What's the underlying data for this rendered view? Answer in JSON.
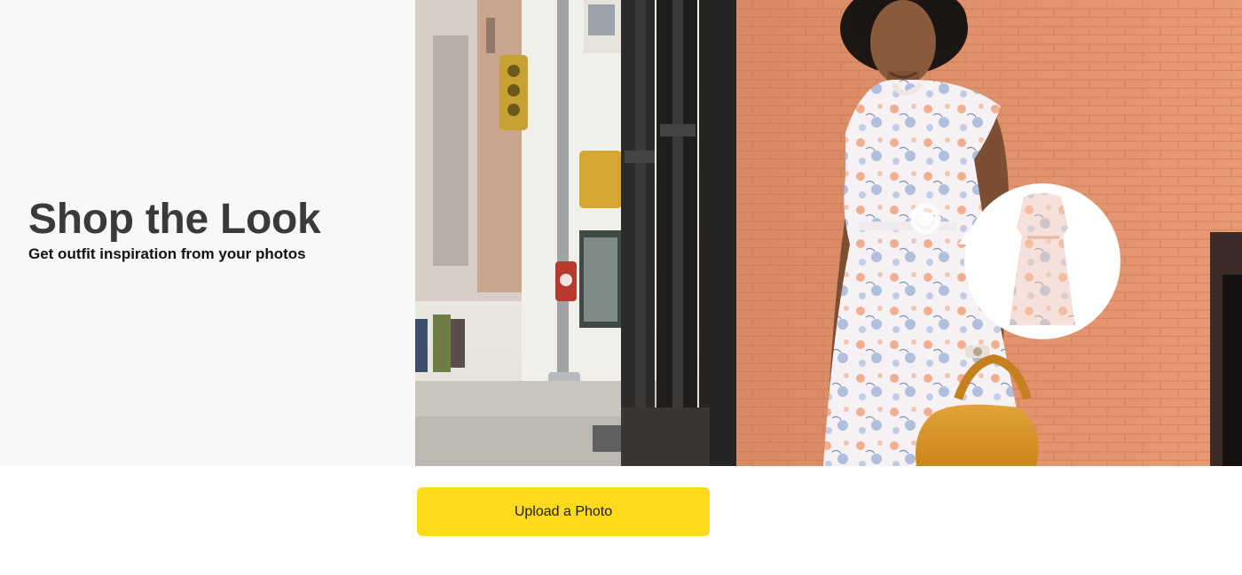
{
  "hero": {
    "title": "Shop the Look",
    "subtitle": "Get outfit inspiration from your photos",
    "background_color": "#f8f8f7"
  },
  "photo": {
    "scene": "street-fashion-photo",
    "product_callout": "dress-product-callout",
    "hotspot": "product-hotspot-icon"
  },
  "cta": {
    "label": "Upload a Photo",
    "color": "#ffd91c"
  }
}
